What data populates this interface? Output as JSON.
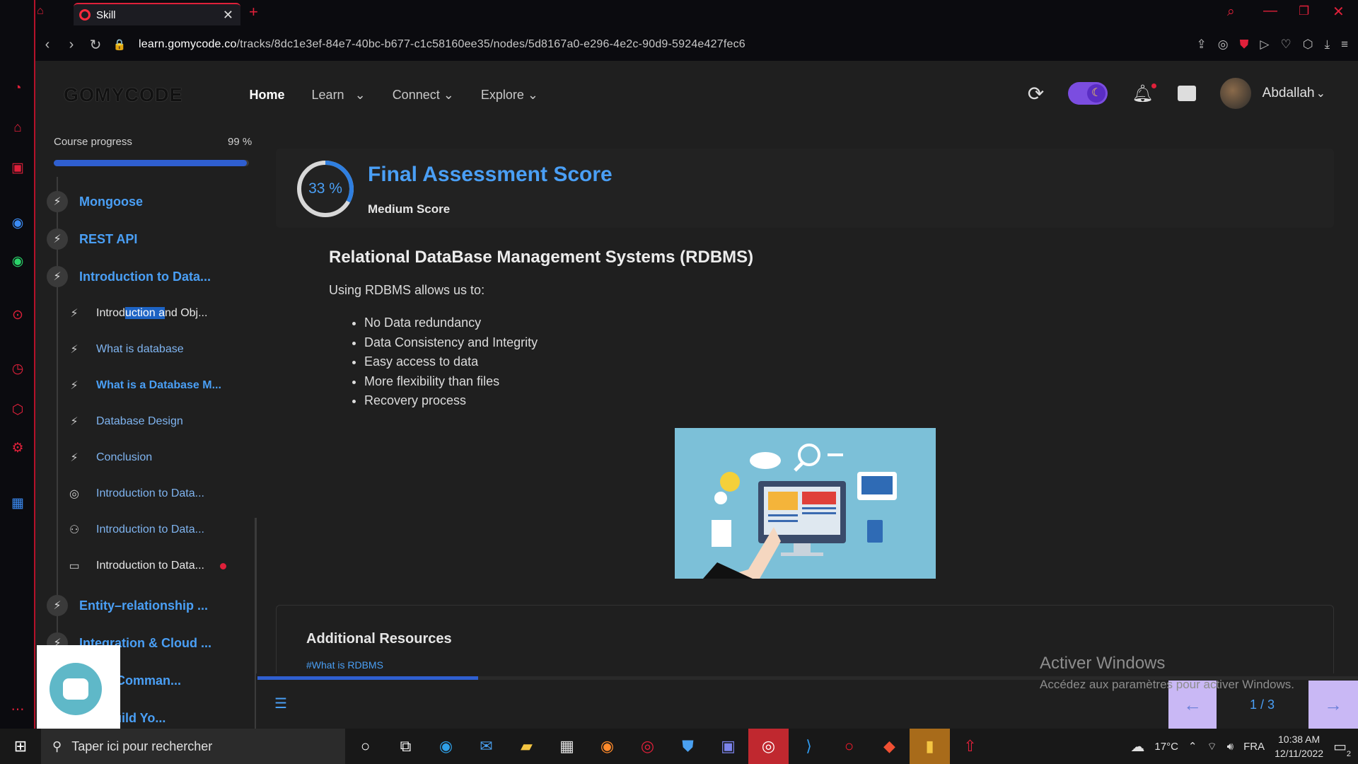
{
  "browser": {
    "tab_title": "Skill",
    "url_domain": "learn.gomycode.co",
    "url_path": "/tracks/8dc1e3ef-84e7-40bc-b677-c1c58160ee35/nodes/5d8167a0-e296-4e2c-90d9-5924e427fec6"
  },
  "header": {
    "logo": "GOMYCODE",
    "nav": [
      {
        "label": "Home"
      },
      {
        "label": "Learn"
      },
      {
        "label": "Connect"
      },
      {
        "label": "Explore"
      }
    ],
    "user_name": "Abdallah"
  },
  "sidebar": {
    "progress_label": "Course progress",
    "progress_value": "99 %",
    "progress_fraction": 0.99,
    "items": [
      {
        "label": "Mongoose",
        "level": "module"
      },
      {
        "label": "REST API",
        "level": "module"
      },
      {
        "label": "Introduction to Data...",
        "level": "module"
      },
      {
        "label_before": "Introd",
        "label_highlight": "uction a",
        "label_after": "nd Obj...",
        "level": "lesson"
      },
      {
        "label": "What is database",
        "level": "lesson"
      },
      {
        "label": "What is a Database M...",
        "level": "lesson",
        "current": true
      },
      {
        "label": "Database Design",
        "level": "lesson"
      },
      {
        "label": "Conclusion",
        "level": "lesson"
      },
      {
        "label": "Introduction to Data...",
        "level": "lesson",
        "icon": "target-icon"
      },
      {
        "label": "Introduction to Data...",
        "level": "lesson",
        "icon": "people-icon"
      },
      {
        "label": "Introduction to Data...",
        "level": "lesson",
        "icon": "presentation-icon"
      },
      {
        "label": "Entity–relationship ...",
        "level": "module"
      },
      {
        "label": "Integration & Cloud ...",
        "level": "module"
      },
      {
        "label": "Flow (Comman...",
        "level": "module"
      },
      {
        "label": "se : Build Yo...",
        "level": "module"
      }
    ]
  },
  "main": {
    "score_percent": "33 %",
    "score_fraction": 0.33,
    "score_title": "Final Assessment Score",
    "score_subtitle": "Medium Score",
    "lesson_title": "Relational DataBase Management Systems (RDBMS)",
    "lesson_intro": "Using RDBMS allows us to:",
    "bullets": [
      "No Data redundancy",
      "Data Consistency and Integrity",
      "Easy access to data",
      "More flexibility than files",
      "Recovery process"
    ],
    "resources_title": "Additional Resources",
    "resources_link": "#What is RDBMS"
  },
  "pager": {
    "text": "1 / 3",
    "prev": "←",
    "next": "→",
    "lesson_progress_fraction": 0.2
  },
  "watermark": {
    "line1": "Activer Windows",
    "line2": "Accédez aux paramètres pour activer Windows."
  },
  "taskbar": {
    "search_placeholder": "Taper ici pour rechercher",
    "weather": "17°C",
    "language": "FRA",
    "time": "10:38 AM",
    "date": "12/11/2022",
    "notification_count": "2"
  },
  "colors": {
    "accent": "#4a9ff5",
    "progress": "#2f5fd0",
    "opera_red": "#e0203a",
    "pager_bg": "#c9b8f5"
  }
}
